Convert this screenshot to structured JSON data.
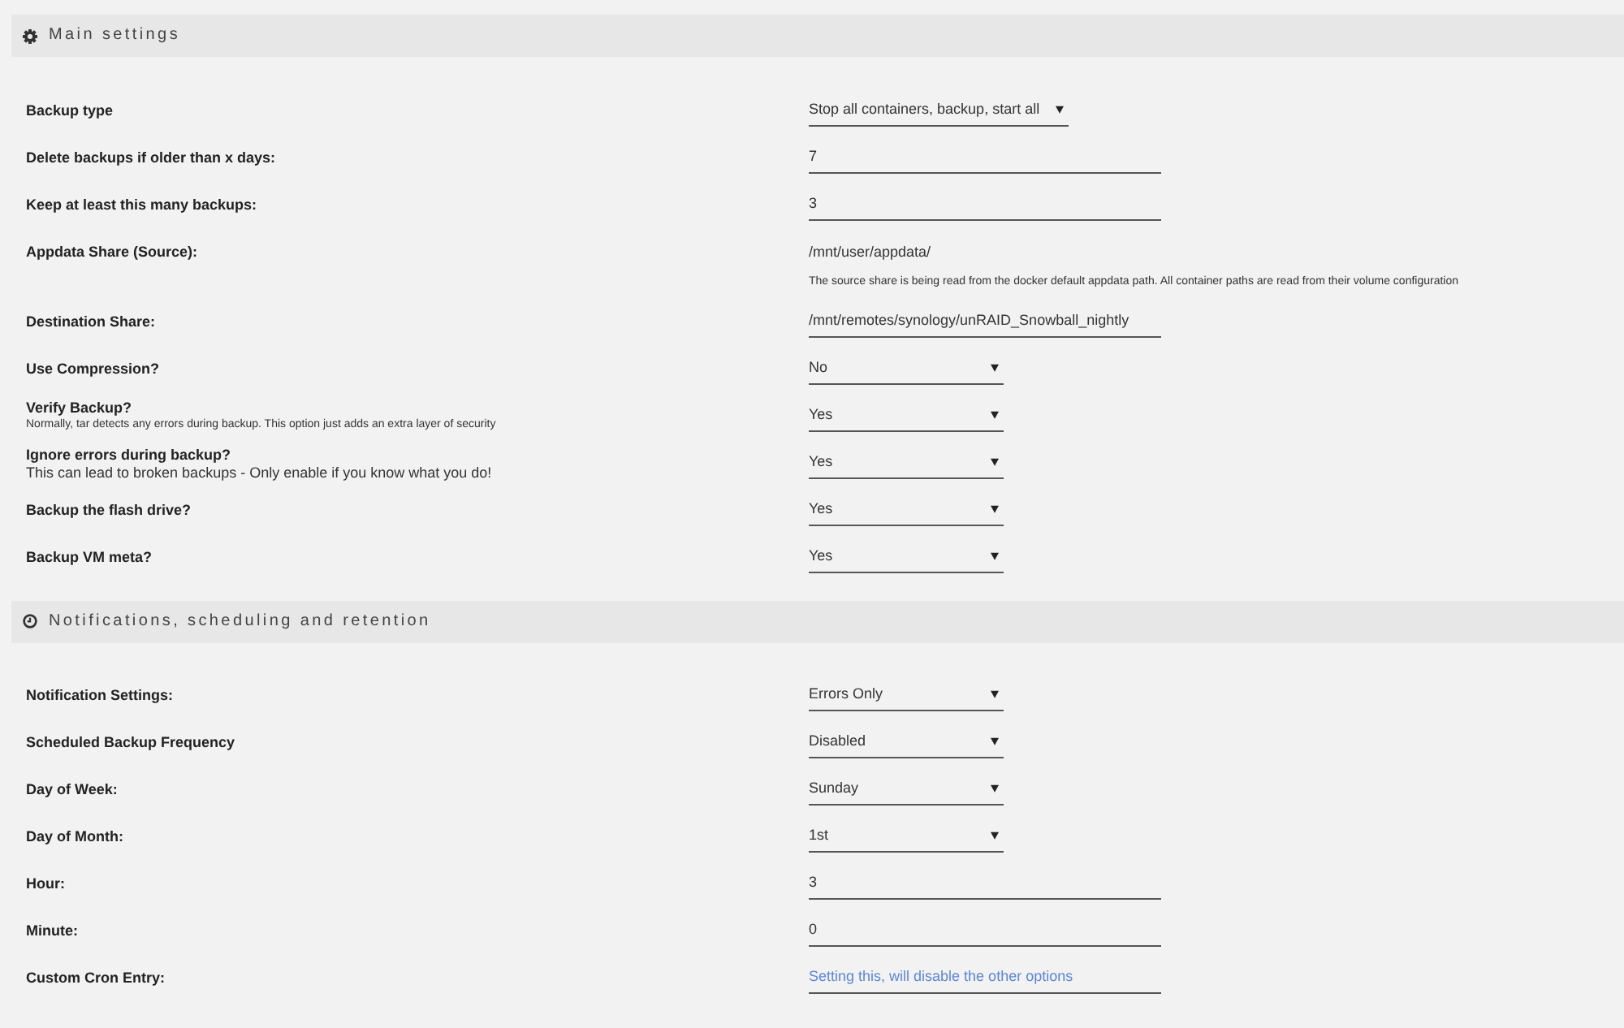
{
  "sections": [
    {
      "title": "Main settings",
      "kind": "general",
      "settings": [
        {
          "label": "Backup type",
          "kind": "select",
          "value": "Stop all containers, backup, start all"
        },
        {
          "label": "Delete backups if older than x days:",
          "kind": "text",
          "value": "7"
        },
        {
          "label": "Keep at least this many backups:",
          "kind": "text",
          "value": "3"
        },
        {
          "label": "Appdata Share (Source):",
          "kind": "static",
          "value": "/mnt/user/appdata/",
          "help": "The source share is being read from the docker default appdata path. All container paths are read from their volume configuration"
        },
        {
          "label": "Destination Share:",
          "kind": "text",
          "value": "/mnt/remotes/synology/unRAID_Snowball_nightly"
        },
        {
          "label": "Use Compression?",
          "kind": "select",
          "value": "No"
        },
        {
          "label": "Verify Backup?",
          "note": {
            "kind": "small",
            "text": "Normally, tar detects any errors during backup. This option just adds an extra layer of security"
          },
          "kind": "select",
          "value": "Yes"
        },
        {
          "label": "Ignore errors during backup?",
          "note": {
            "kind": "plain",
            "text": "This can lead to broken backups - Only enable if you know what you do!"
          },
          "kind": "select",
          "value": "Yes"
        },
        {
          "label": "Backup the flash drive?",
          "kind": "select",
          "value": "Yes"
        },
        {
          "label": "Backup VM meta?",
          "kind": "select",
          "value": "Yes"
        }
      ]
    },
    {
      "title": "Notifications, scheduling and retention",
      "kind": "schedule",
      "settings": [
        {
          "label": "Notification Settings:",
          "kind": "select",
          "value": "Errors Only"
        },
        {
          "label": "Scheduled Backup Frequency",
          "kind": "select",
          "value": "Disabled"
        },
        {
          "label": "Day of Week:",
          "kind": "select",
          "value": "Sunday"
        },
        {
          "label": "Day of Month:",
          "kind": "select",
          "value": "1st"
        },
        {
          "label": "Hour:",
          "kind": "text",
          "value": "3"
        },
        {
          "label": "Minute:",
          "kind": "text",
          "value": "0"
        },
        {
          "label": "Custom Cron Entry:",
          "kind": "text",
          "placeholder": "Setting this, will disable the other options"
        }
      ]
    }
  ]
}
